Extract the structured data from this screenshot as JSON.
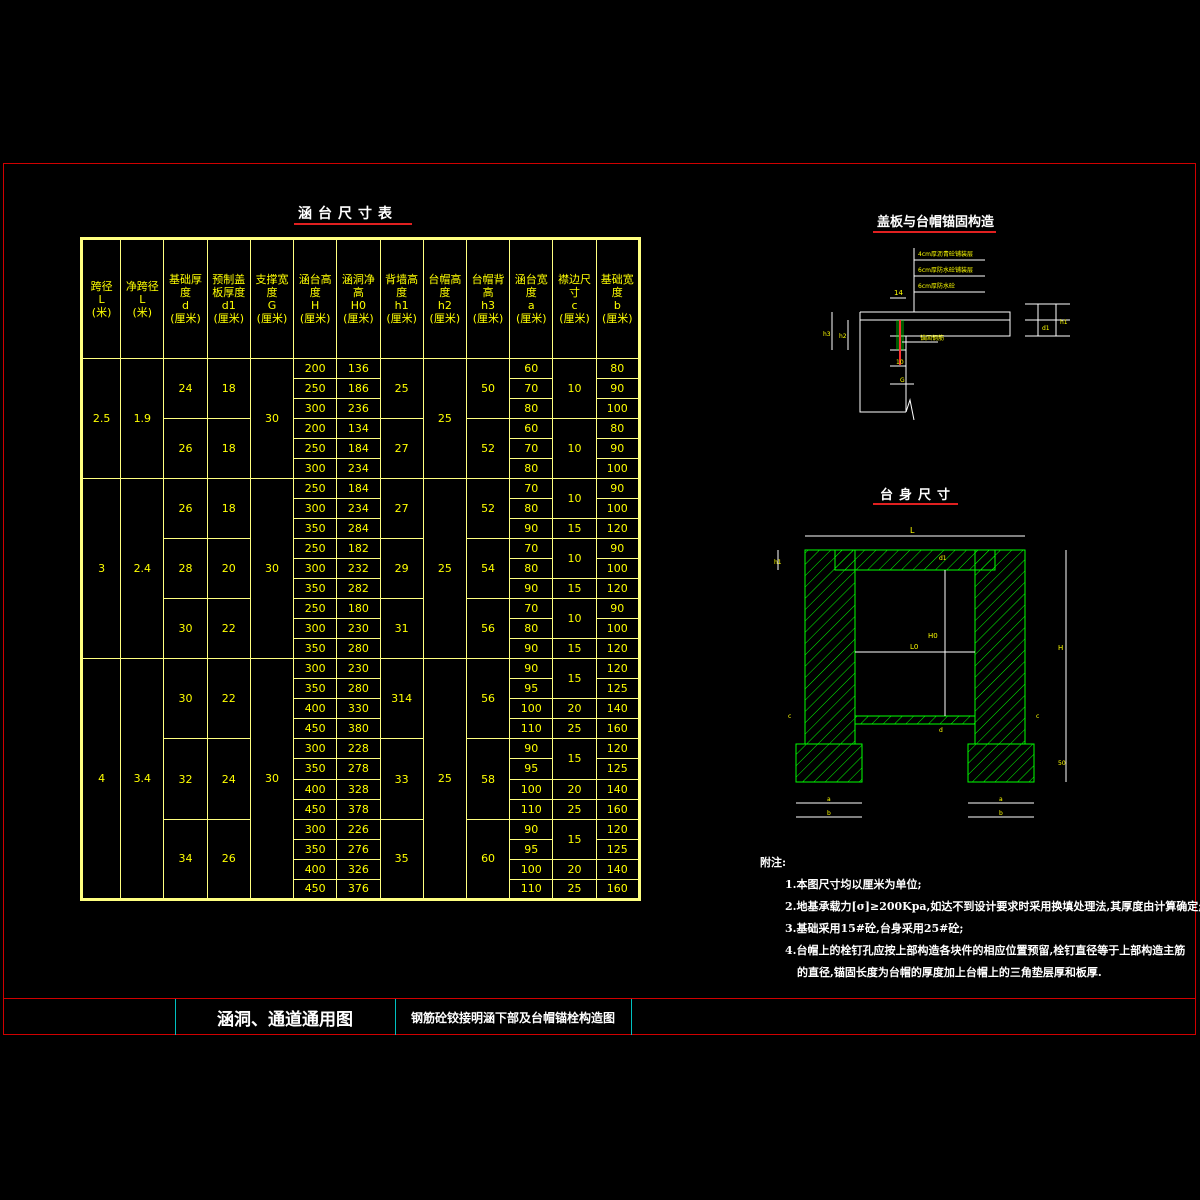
{
  "table_title": "涵台尺寸表",
  "table": {
    "headers": [
      "跨径\nL\n(米)",
      "净跨径\nL\n(米)",
      "基础厚度\nd\n(厘米)",
      "预制盖板厚度\nd1\n(厘米)",
      "支撑宽度\nG\n(厘米)",
      "涵台高度\nH\n(厘米)",
      "涵洞净高\nH0\n(厘米)",
      "背墙高度\nh1\n(厘米)",
      "台帽高度\nh2\n(厘米)",
      "台帽背高\nh3\n(厘米)",
      "涵台宽度\na\n(厘米)",
      "襟边尺寸\nc\n(厘米)",
      "基础宽度\nb\n(厘米)"
    ],
    "groups": [
      {
        "span": "2.5",
        "net": "1.9",
        "G": "30",
        "h2": "25",
        "subs": [
          {
            "d": "24",
            "d1": "18",
            "h1": "25",
            "h3": "50",
            "rows": [
              [
                "200",
                "136",
                "60",
                "10",
                "80"
              ],
              [
                "250",
                "186",
                "70",
                "10",
                "90"
              ],
              [
                "300",
                "236",
                "80",
                "10",
                "100"
              ]
            ],
            "c_merge": [
              [
                0,
                3,
                "10"
              ]
            ]
          },
          {
            "d": "26",
            "d1": "18",
            "h1": "27",
            "h3": "52",
            "rows": [
              [
                "200",
                "134",
                "60",
                "10",
                "80"
              ],
              [
                "250",
                "184",
                "70",
                "10",
                "90"
              ],
              [
                "300",
                "234",
                "80",
                "10",
                "100"
              ]
            ],
            "c_merge": [
              [
                0,
                3,
                "10"
              ]
            ]
          }
        ]
      },
      {
        "span": "3",
        "net": "2.4",
        "G": "30",
        "h2": "25",
        "subs": [
          {
            "d": "26",
            "d1": "18",
            "h1": "27",
            "h3": "52",
            "rows": [
              [
                "250",
                "184",
                "70",
                "",
                "90"
              ],
              [
                "300",
                "234",
                "80",
                "",
                "100"
              ],
              [
                "350",
                "284",
                "90",
                "15",
                "120"
              ]
            ],
            "c_merge": [
              [
                0,
                2,
                "10"
              ],
              [
                2,
                1,
                "15"
              ]
            ]
          },
          {
            "d": "28",
            "d1": "20",
            "h1": "29",
            "h3": "54",
            "rows": [
              [
                "250",
                "182",
                "70",
                "",
                "90"
              ],
              [
                "300",
                "232",
                "80",
                "",
                "100"
              ],
              [
                "350",
                "282",
                "90",
                "15",
                "120"
              ]
            ],
            "c_merge": [
              [
                0,
                2,
                "10"
              ],
              [
                2,
                1,
                "15"
              ]
            ]
          },
          {
            "d": "30",
            "d1": "22",
            "h1": "31",
            "h3": "56",
            "rows": [
              [
                "250",
                "180",
                "70",
                "",
                "90"
              ],
              [
                "300",
                "230",
                "80",
                "",
                "100"
              ],
              [
                "350",
                "280",
                "90",
                "15",
                "120"
              ]
            ],
            "c_merge": [
              [
                0,
                2,
                "10"
              ],
              [
                2,
                1,
                "15"
              ]
            ]
          }
        ]
      },
      {
        "span": "4",
        "net": "3.4",
        "G": "30",
        "h2": "25",
        "subs": [
          {
            "d": "30",
            "d1": "22",
            "h1": "314",
            "h3": "56",
            "rows": [
              [
                "300",
                "230",
                "90",
                "",
                "120"
              ],
              [
                "350",
                "280",
                "95",
                "",
                "125"
              ],
              [
                "400",
                "330",
                "100",
                "20",
                "140"
              ],
              [
                "450",
                "380",
                "110",
                "25",
                "160"
              ]
            ],
            "c_merge": [
              [
                0,
                2,
                "15"
              ],
              [
                2,
                1,
                "20"
              ],
              [
                3,
                1,
                "25"
              ]
            ]
          },
          {
            "d": "32",
            "d1": "24",
            "h1": "33",
            "h3": "58",
            "rows": [
              [
                "300",
                "228",
                "90",
                "",
                "120"
              ],
              [
                "350",
                "278",
                "95",
                "",
                "125"
              ],
              [
                "400",
                "328",
                "100",
                "20",
                "140"
              ],
              [
                "450",
                "378",
                "110",
                "25",
                "160"
              ]
            ],
            "c_merge": [
              [
                0,
                2,
                "15"
              ],
              [
                2,
                1,
                "20"
              ],
              [
                3,
                1,
                "25"
              ]
            ]
          },
          {
            "d": "34",
            "d1": "26",
            "h1": "35",
            "h3": "60",
            "rows": [
              [
                "300",
                "226",
                "90",
                "",
                "120"
              ],
              [
                "350",
                "276",
                "95",
                "",
                "125"
              ],
              [
                "400",
                "326",
                "100",
                "20",
                "140"
              ],
              [
                "450",
                "376",
                "110",
                "25",
                "160"
              ]
            ],
            "c_merge": [
              [
                0,
                2,
                "15"
              ],
              [
                2,
                1,
                "20"
              ],
              [
                3,
                1,
                "25"
              ]
            ]
          }
        ]
      }
    ]
  },
  "detail1": {
    "title": "盖板与台帽锚固构造",
    "callouts": [
      "4cm厚沥青砼铺装层",
      "6cm厚防水砼铺装层",
      "6cm厚防水砼"
    ],
    "anchor_label": "锚固钢筋",
    "dims": {
      "top": "14",
      "left1": "h3",
      "left2": "h2",
      "bot1": "10",
      "bot2": "G",
      "right1": "d1",
      "right2": "h1"
    }
  },
  "detail2": {
    "title": "台身尺寸",
    "dims": {
      "L": "L",
      "L0": "L0",
      "H0": "H0",
      "H": "H",
      "d": "d",
      "d1": "d1",
      "c": "c",
      "a": "a",
      "b": "b",
      "h1": "h1",
      "h2": "h2",
      "base": "50"
    }
  },
  "notes": {
    "heading": "附注:",
    "items": [
      "1.本图尺寸均以厘米为单位;",
      "2.地基承载力[σ]≥200Kpa,如达不到设计要求时采用换填处理法,其厚度由计算确定;",
      "3.基础采用15#砼,台身采用25#砼;",
      "4.台帽上的栓钉孔应按上部构造各块件的相应位置预留,栓钉直径等于上部构造主筋",
      "的直径,锚固长度为台帽的厚度加上台帽上的三角垫层厚和板厚."
    ]
  },
  "title_block": {
    "main": "涵洞、通道通用图",
    "sub": "钢筋砼铰接明涵下部及台帽锚栓构造图"
  },
  "colors": {
    "border": "#d00000",
    "table": "#ffff80",
    "text": "#ffff00",
    "hatch": "#00ff00",
    "dim": "#ffffff",
    "accent": "#e02020"
  }
}
